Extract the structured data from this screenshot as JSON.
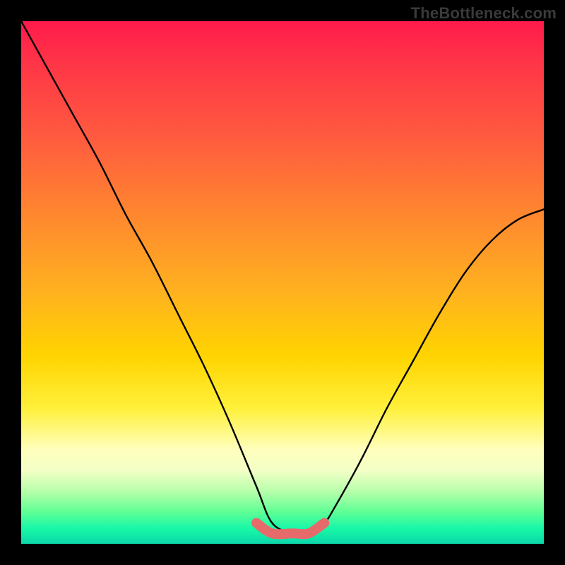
{
  "watermark": "TheBottleneck.com",
  "chart_data": {
    "type": "line",
    "title": "",
    "xlabel": "",
    "ylabel": "",
    "xlim": [
      0,
      1
    ],
    "ylim": [
      0,
      1
    ],
    "grid": false,
    "legend": false,
    "series": [
      {
        "name": "bottleneck-curve",
        "color": "#000000",
        "x": [
          0.0,
          0.05,
          0.1,
          0.15,
          0.2,
          0.25,
          0.3,
          0.35,
          0.4,
          0.45,
          0.48,
          0.52,
          0.55,
          0.58,
          0.6,
          0.65,
          0.7,
          0.75,
          0.8,
          0.85,
          0.9,
          0.95,
          1.0
        ],
        "y": [
          1.0,
          0.91,
          0.82,
          0.73,
          0.63,
          0.54,
          0.44,
          0.34,
          0.23,
          0.11,
          0.04,
          0.02,
          0.02,
          0.04,
          0.07,
          0.16,
          0.26,
          0.35,
          0.44,
          0.52,
          0.58,
          0.62,
          0.64
        ]
      },
      {
        "name": "optimal-range-highlight",
        "color": "#e76a6a",
        "x": [
          0.45,
          0.48,
          0.52,
          0.55,
          0.58
        ],
        "y": [
          0.04,
          0.02,
          0.02,
          0.02,
          0.04
        ]
      }
    ],
    "background_gradient": {
      "orientation": "vertical",
      "stops": [
        {
          "pos": 0.0,
          "color": "#ff1a4b"
        },
        {
          "pos": 0.5,
          "color": "#ffb21f"
        },
        {
          "pos": 0.74,
          "color": "#fff03a"
        },
        {
          "pos": 0.88,
          "color": "#b6ffaa"
        },
        {
          "pos": 1.0,
          "color": "#0be8b0"
        }
      ]
    }
  }
}
